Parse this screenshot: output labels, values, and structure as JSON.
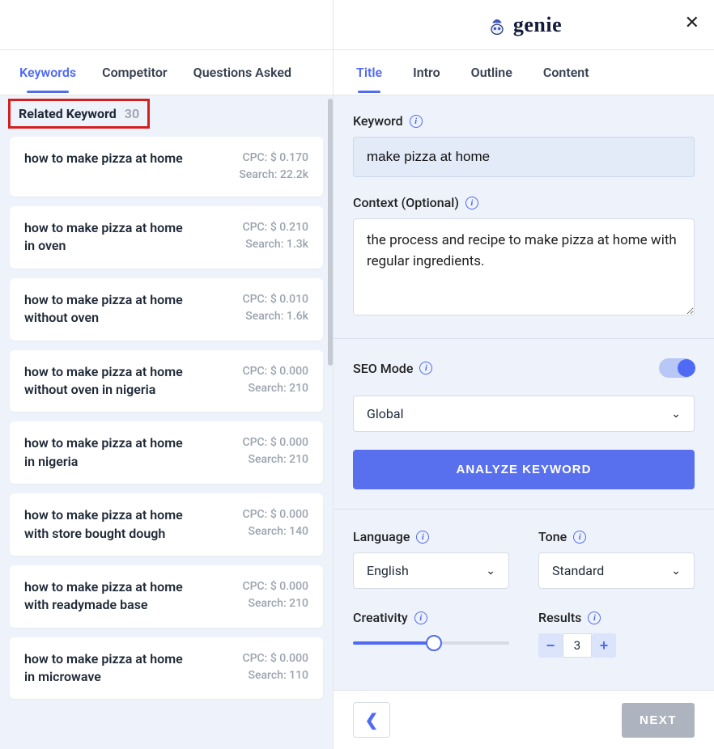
{
  "logo_text": "genie",
  "left_tabs": [
    "Keywords",
    "Competitor",
    "Questions Asked"
  ],
  "left_active_tab": 0,
  "related_keyword_label": "Related Keyword",
  "related_keyword_count": "30",
  "cpc_prefix": "CPC: $ ",
  "search_prefix": "Search: ",
  "keywords": [
    {
      "text": "how to make pizza at home",
      "cpc": "0.170",
      "search": "22.2k"
    },
    {
      "text": "how to make pizza at home in oven",
      "cpc": "0.210",
      "search": "1.3k"
    },
    {
      "text": "how to make pizza at home without oven",
      "cpc": "0.010",
      "search": "1.6k"
    },
    {
      "text": "how to make pizza at home without oven in nigeria",
      "cpc": "0.000",
      "search": "210"
    },
    {
      "text": "how to make pizza at home in nigeria",
      "cpc": "0.000",
      "search": "210"
    },
    {
      "text": "how to make pizza at home with store bought dough",
      "cpc": "0.000",
      "search": "140"
    },
    {
      "text": "how to make pizza at home with readymade base",
      "cpc": "0.000",
      "search": "210"
    },
    {
      "text": "how to make pizza at home in microwave",
      "cpc": "0.000",
      "search": "110"
    }
  ],
  "right_tabs": [
    "Title",
    "Intro",
    "Outline",
    "Content"
  ],
  "right_active_tab": 0,
  "form": {
    "keyword_label": "Keyword",
    "keyword_value": "make pizza at home",
    "context_label": "Context (Optional)",
    "context_value": "the process and recipe to make pizza at home with regular ingredients.",
    "seo_label": "SEO Mode",
    "seo_on": true,
    "region_value": "Global",
    "analyze_label": "ANALYZE KEYWORD",
    "language_label": "Language",
    "language_value": "English",
    "tone_label": "Tone",
    "tone_value": "Standard",
    "creativity_label": "Creativity",
    "results_label": "Results",
    "results_value": "3"
  },
  "footer": {
    "next_label": "NEXT"
  }
}
